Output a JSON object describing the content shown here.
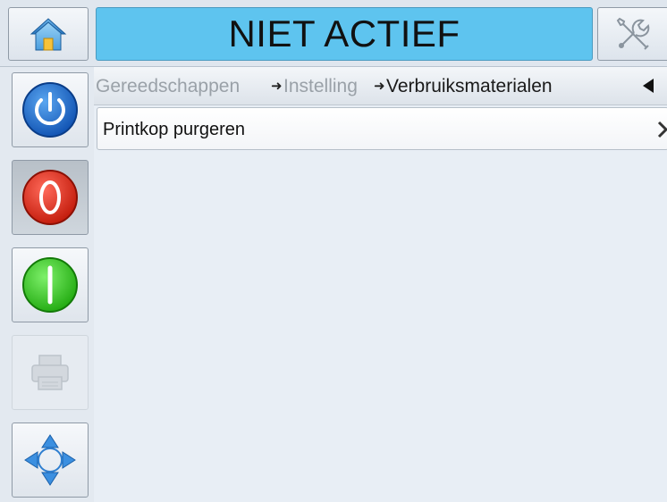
{
  "header": {
    "status_text": "NIET ACTIEF",
    "status_color": "#5ec4ef"
  },
  "icons": {
    "home": "home-icon",
    "tools": "tools-icon",
    "power": "power-icon",
    "stop": "stop-icon",
    "start": "start-icon",
    "print": "printer-icon",
    "navigate": "navigate-icon"
  },
  "breadcrumb": {
    "items": [
      "Gereedschappen",
      "Instelling",
      "Verbruiksmaterialen"
    ]
  },
  "menu": {
    "items": [
      {
        "label": "Printkop purgeren"
      }
    ]
  }
}
